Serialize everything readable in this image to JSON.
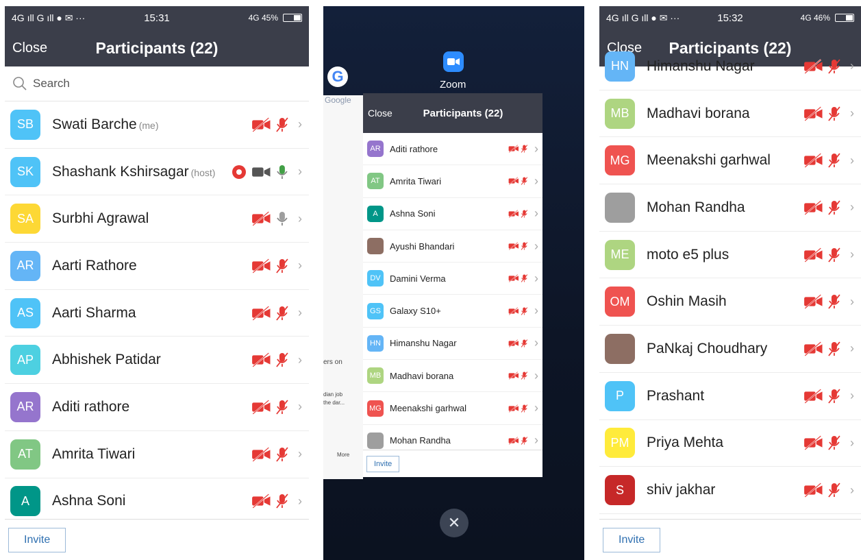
{
  "left": {
    "status": {
      "signal": "4G ıll G ıll ● ✉ ···",
      "time": "15:31",
      "right": "4G 45%"
    },
    "header": {
      "close": "Close",
      "title": "Participants (22)"
    },
    "search_placeholder": "Search",
    "participants": [
      {
        "initials": "SB",
        "name": "Swati Barche",
        "tag": "(me)",
        "color": "#4fc3f7"
      },
      {
        "initials": "SK",
        "name": "Shashank Kshirsagar",
        "tag": "(host)",
        "color": "#4fc3f7"
      },
      {
        "initials": "SA",
        "name": "Surbhi Agrawal",
        "tag": "",
        "color": "#fdd835"
      },
      {
        "initials": "AR",
        "name": "Aarti Rathore",
        "tag": "",
        "color": "#64b5f6"
      },
      {
        "initials": "AS",
        "name": "Aarti Sharma",
        "tag": "",
        "color": "#4fc3f7"
      },
      {
        "initials": "AP",
        "name": "Abhishek Patidar",
        "tag": "",
        "color": "#4dd0e1"
      },
      {
        "initials": "AR",
        "name": "Aditi rathore",
        "tag": "",
        "color": "#9575cd"
      },
      {
        "initials": "AT",
        "name": "Amrita Tiwari",
        "tag": "",
        "color": "#81c784"
      },
      {
        "initials": "A",
        "name": "Ashna Soni",
        "tag": "",
        "color": "#009688"
      }
    ],
    "invite": "Invite"
  },
  "middle": {
    "google_label": "Google",
    "zoom_label": "Zoom",
    "header": {
      "close": "Close",
      "title": "Participants (22)"
    },
    "participants": [
      {
        "initials": "AR",
        "name": "Aditi rathore",
        "color": "#9575cd"
      },
      {
        "initials": "AT",
        "name": "Amrita Tiwari",
        "color": "#81c784"
      },
      {
        "initials": "A",
        "name": "Ashna Soni",
        "color": "#009688"
      },
      {
        "initials": "",
        "name": "Ayushi Bhandari",
        "color": "#8d6e63"
      },
      {
        "initials": "DV",
        "name": "Damini Verma",
        "color": "#4fc3f7"
      },
      {
        "initials": "GS",
        "name": "Galaxy S10+",
        "color": "#4fc3f7"
      },
      {
        "initials": "HN",
        "name": "Himanshu Nagar",
        "color": "#64b5f6"
      },
      {
        "initials": "MB",
        "name": "Madhavi borana",
        "color": "#aed581"
      },
      {
        "initials": "MG",
        "name": "Meenakshi garhwal",
        "color": "#ef5350"
      },
      {
        "initials": "",
        "name": "Mohan Randha",
        "color": "#9e9e9e"
      }
    ],
    "snippets": [
      "ers on",
      "dian job",
      "the dar...",
      "More"
    ],
    "invite": "Invite"
  },
  "right": {
    "status": {
      "signal": "4G ıll G ıll ● ✉ ···",
      "time": "15:32",
      "right": "4G 46%"
    },
    "header": {
      "close": "Close",
      "title": "Participants (22)"
    },
    "participants": [
      {
        "initials": "HN",
        "name": "Himanshu Nagar",
        "color": "#64b5f6"
      },
      {
        "initials": "MB",
        "name": "Madhavi borana",
        "color": "#aed581"
      },
      {
        "initials": "MG",
        "name": "Meenakshi garhwal",
        "color": "#ef5350"
      },
      {
        "initials": "",
        "name": "Mohan Randha",
        "color": "#9e9e9e"
      },
      {
        "initials": "ME",
        "name": "moto e5 plus",
        "color": "#aed581"
      },
      {
        "initials": "OM",
        "name": "Oshin Masih",
        "color": "#ef5350"
      },
      {
        "initials": "",
        "name": "PaNkaj Choudhary",
        "color": "#8d6e63"
      },
      {
        "initials": "P",
        "name": "Prashant",
        "color": "#4fc3f7"
      },
      {
        "initials": "PM",
        "name": "Priya Mehta",
        "color": "#ffeb3b"
      },
      {
        "initials": "S",
        "name": "shiv jakhar",
        "color": "#c62828"
      }
    ],
    "invite": "Invite"
  }
}
